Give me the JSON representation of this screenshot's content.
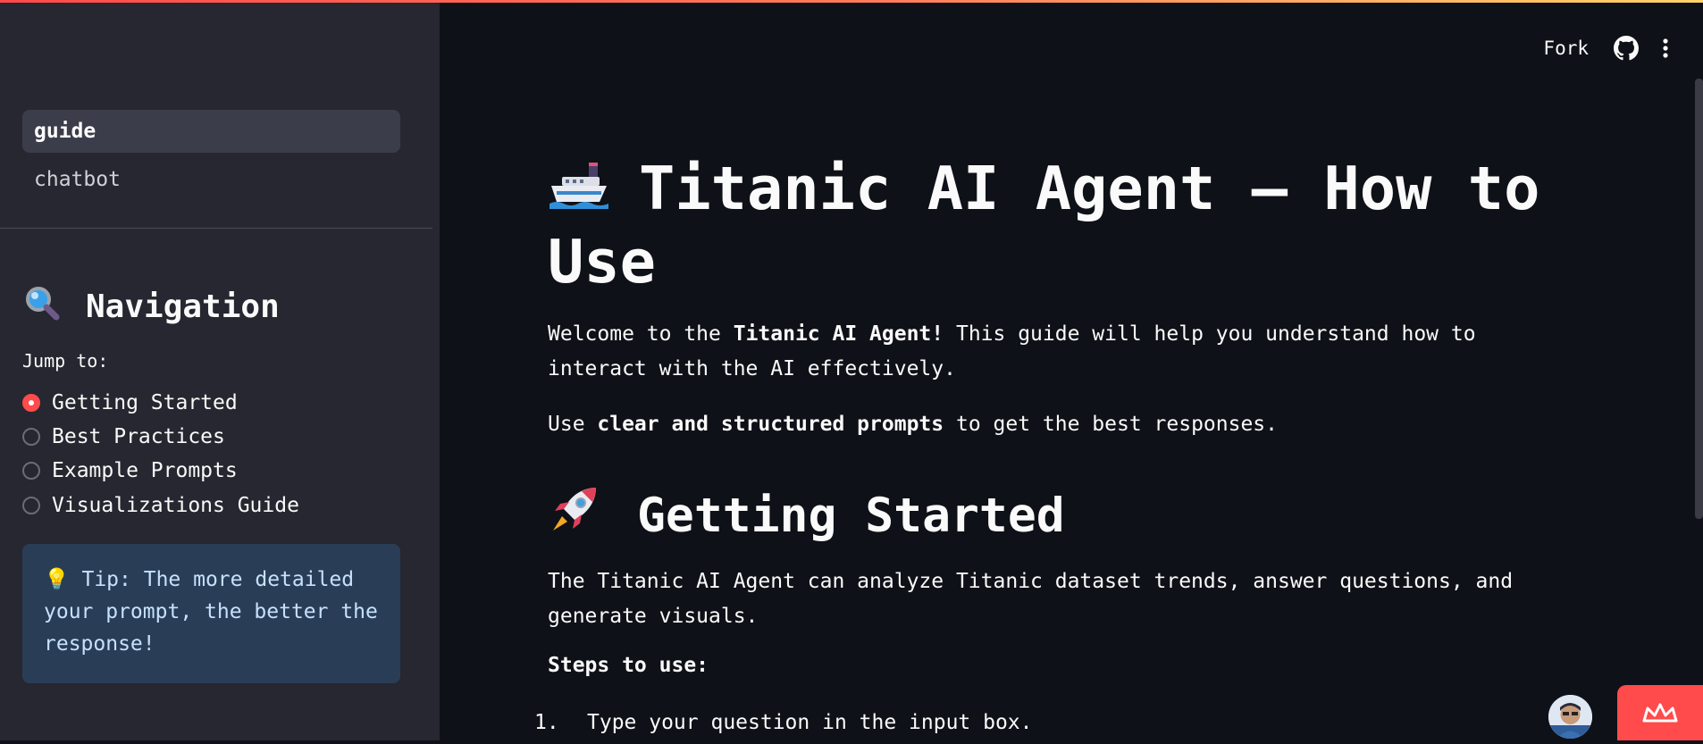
{
  "sidebar": {
    "pages": [
      {
        "label": "guide",
        "active": true
      },
      {
        "label": "chatbot",
        "active": false
      }
    ],
    "navigation": {
      "heading": "Navigation",
      "heading_icon": "magnifier-icon",
      "jump_label": "Jump to:",
      "options": [
        {
          "label": "Getting Started",
          "selected": true
        },
        {
          "label": "Best Practices",
          "selected": false
        },
        {
          "label": "Example Prompts",
          "selected": false
        },
        {
          "label": "Visualizations Guide",
          "selected": false
        }
      ]
    },
    "tip": "💡 Tip: The more detailed your prompt, the better the response!"
  },
  "header": {
    "fork_label": "Fork",
    "github_icon": "github-icon",
    "menu_icon": "kebab-menu-icon"
  },
  "main": {
    "title_icon": "ship-icon",
    "title": "Titanic AI Agent – How to Use",
    "intro": {
      "prefix": "Welcome to the ",
      "bold": "Titanic AI Agent!",
      "suffix": " This guide will help you understand how to interact with the AI effectively."
    },
    "prompt_tip": {
      "prefix": "Use ",
      "bold": "clear and structured prompts",
      "suffix": " to get the best responses."
    },
    "section": {
      "icon": "rocket-icon",
      "heading": "Getting Started",
      "description": "The Titanic AI Agent can analyze Titanic dataset trends, answer questions, and generate visuals.",
      "steps_label": "Steps to use:",
      "steps": [
        {
          "number": "1.",
          "text": "Type your question in the input box."
        }
      ]
    }
  },
  "colors": {
    "accent": "#ff4b4b",
    "background": "#0e1117",
    "sidebar": "#262730",
    "tip_box": "#2a3d57"
  }
}
